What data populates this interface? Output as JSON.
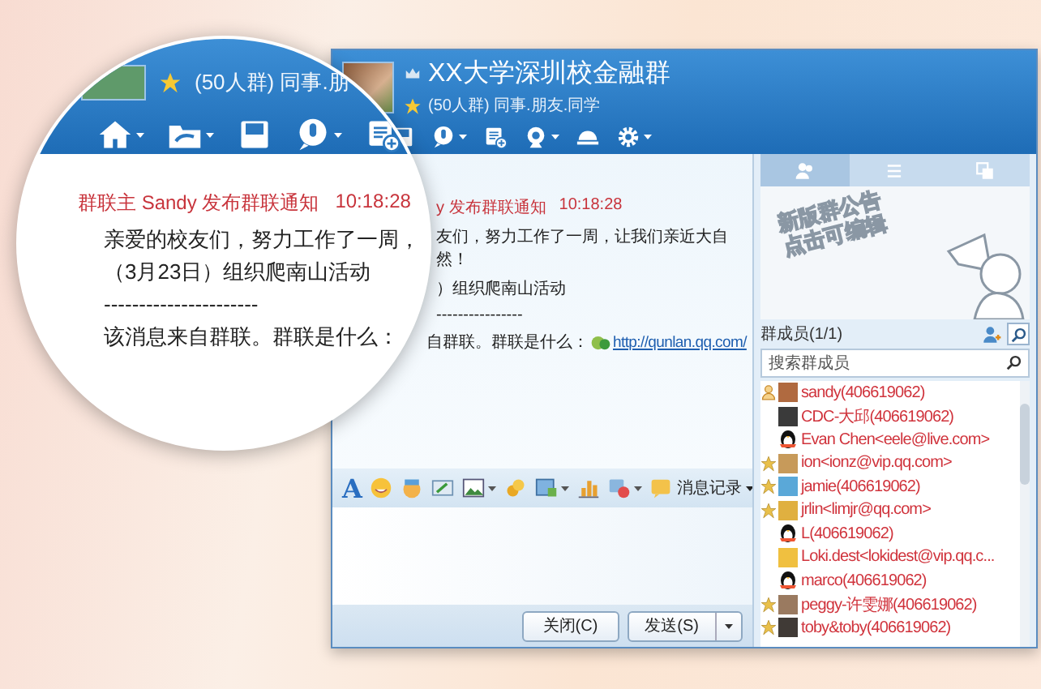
{
  "window": {
    "title": "XX大学深圳校金融群",
    "info": "(50人群) 同事.朋友.同学"
  },
  "chat": {
    "sender": "y 发布群联通知",
    "time": "10:18:28",
    "lines": [
      "友们，努力工作了一周，让我们亲近大自然！",
      "）组织爬南山活动",
      "----------------"
    ],
    "link_prefix": "自群联。群联是什么：",
    "link": "http://qunlan.qq.com/"
  },
  "magnifier": {
    "info": "(50人群) 同事.朋",
    "sender": "群联主 Sandy 发布群联通知",
    "time": "10:18:28",
    "lines": [
      "亲爱的校友们，努力工作了一周，",
      "（3月23日）组织爬南山活动",
      "----------------------",
      "该消息来自群联。群联是什么："
    ]
  },
  "input_toolbar": {
    "font_button": "A",
    "history_button": "消息记录"
  },
  "buttons": {
    "close": "关闭(C)",
    "send": "发送(S)"
  },
  "sidebar": {
    "tabs": [
      {
        "selected": true
      },
      {
        "selected": false
      },
      {
        "selected": false
      }
    ],
    "announcement": [
      "新版群公告",
      "点击可编辑"
    ],
    "members_title": "群成员(1/1)",
    "search": {
      "placeholder": "搜索群成员"
    },
    "members": [
      {
        "name": "sandy(406619062)",
        "kind": "owner",
        "default_avatar": false
      },
      {
        "name": "CDC-大邱(406619062)",
        "kind": "member",
        "default_avatar": false
      },
      {
        "name": "Evan Chen<eele@live.com>",
        "kind": "member",
        "default_avatar": true
      },
      {
        "name": "ion<ionz@vip.qq.com>",
        "kind": "admin",
        "default_avatar": false
      },
      {
        "name": "jamie(406619062)",
        "kind": "admin",
        "default_avatar": false
      },
      {
        "name": "jrlin<limjr@qq.com>",
        "kind": "admin",
        "default_avatar": false
      },
      {
        "name": "L(406619062)",
        "kind": "member",
        "default_avatar": true
      },
      {
        "name": "Loki.dest<lokidest@vip.qq.c...",
        "kind": "member",
        "default_avatar": false
      },
      {
        "name": "marco(406619062)",
        "kind": "member",
        "default_avatar": true
      },
      {
        "name": "peggy-许雯娜(406619062)",
        "kind": "admin",
        "default_avatar": false
      },
      {
        "name": "toby&toby(406619062)",
        "kind": "admin",
        "default_avatar": false
      }
    ]
  }
}
